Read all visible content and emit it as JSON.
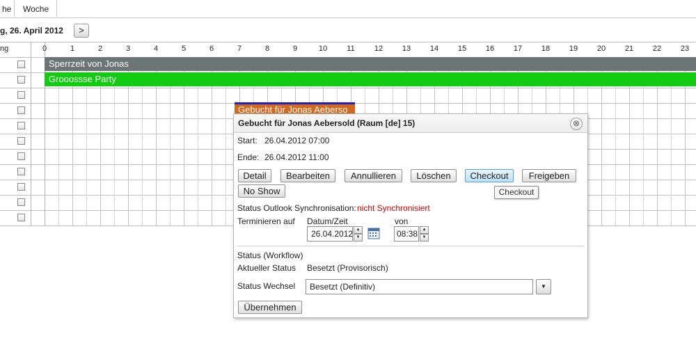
{
  "tabs": [
    "he",
    "Woche"
  ],
  "date_label": "g, 26. April 2012",
  "nav_next_glyph": ">",
  "grid": {
    "row_header": "ng",
    "hours": [
      "0",
      "1",
      "2",
      "3",
      "4",
      "5",
      "6",
      "7",
      "8",
      "9",
      "10",
      "11",
      "12",
      "13",
      "14",
      "15",
      "16",
      "17",
      "18",
      "19",
      "20",
      "21",
      "22",
      "23"
    ]
  },
  "events": [
    {
      "label": "Sperrzeit von Jonas",
      "color": "#6b7573"
    },
    {
      "label": "Grooossse Party",
      "color": "#11cc11"
    }
  ],
  "booking_label": "Gebucht für Jonas Aeberso",
  "popup": {
    "title": "Gebucht für Jonas Aebersold (Raum [de] 15)",
    "close_glyph": "⊗",
    "start_label": "Start:",
    "start_value": "26.04.2012 07:00",
    "end_label": "Ende:",
    "end_value": "26.04.2012 11:00",
    "buttons": {
      "detail": "Detail",
      "edit": "Bearbeiten",
      "cancel": "Annullieren",
      "delete": "Löschen",
      "checkout": "Checkout",
      "release": "Freigeben",
      "noshow": "No Show"
    },
    "tooltip": "Checkout",
    "sync_label": "Status Outlook Synchronisation:",
    "sync_value": "nicht Synchronisiert",
    "schedule_label": "Terminieren auf",
    "date_time_label": "Datum/Zeit",
    "from_label": "von",
    "date_value": "26.04.2012",
    "time_value": "08:38",
    "workflow_label": "Status (Workflow)",
    "current_status_label": "Aktueller Status",
    "current_status_value": "Besetzt (Provisorisch)",
    "status_change_label": "Status Wechsel",
    "status_change_value": "Besetzt (Definitiv)",
    "apply_button": "Übernehmen"
  },
  "colors": {
    "active_button": "#bfe0f7",
    "status_error": "#cc0000"
  }
}
